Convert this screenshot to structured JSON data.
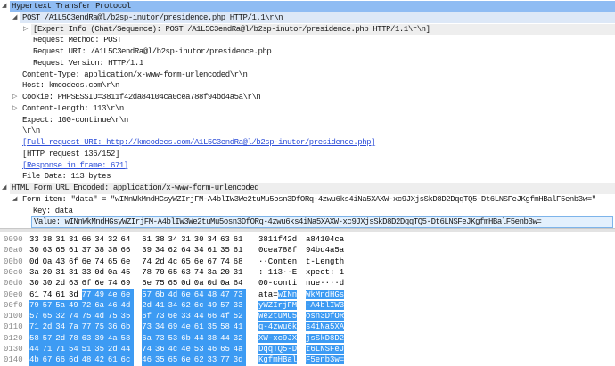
{
  "tree": [
    {
      "indent": 0,
      "toggle": "expanded",
      "text": "Hypertext Transfer Protocol",
      "style": "sel1"
    },
    {
      "indent": 1,
      "toggle": "expanded",
      "text": "POST /A1L5C3endRa@l/b2sp-inutor/presidence.php HTTP/1.1\\r\\n",
      "style": "sel2"
    },
    {
      "indent": 2,
      "toggle": "collapsed",
      "text": "[Expert Info (Chat/Sequence): POST /A1L5C3endRa@l/b2sp-inutor/presidence.php HTTP/1.1\\r\\n]",
      "style": "gray"
    },
    {
      "indent": 2,
      "toggle": "",
      "text": "Request Method: POST",
      "style": ""
    },
    {
      "indent": 2,
      "toggle": "",
      "text": "Request URI: /A1L5C3endRa@l/b2sp-inutor/presidence.php",
      "style": ""
    },
    {
      "indent": 2,
      "toggle": "",
      "text": "Request Version: HTTP/1.1",
      "style": ""
    },
    {
      "indent": 1,
      "toggle": "",
      "text": "Content-Type: application/x-www-form-urlencoded\\r\\n",
      "style": ""
    },
    {
      "indent": 1,
      "toggle": "",
      "text": "Host: kmcodecs.com\\r\\n",
      "style": ""
    },
    {
      "indent": 1,
      "toggle": "collapsed",
      "text": "Cookie: PHPSESSID=3811f42da84104ca0cea788f94bd4a5a\\r\\n",
      "style": ""
    },
    {
      "indent": 1,
      "toggle": "collapsed",
      "text": "Content-Length: 113\\r\\n",
      "style": ""
    },
    {
      "indent": 1,
      "toggle": "",
      "text": "Expect: 100-continue\\r\\n",
      "style": ""
    },
    {
      "indent": 1,
      "toggle": "",
      "text": "\\r\\n",
      "style": ""
    },
    {
      "indent": 1,
      "toggle": "",
      "text": "[Full request URI: http://kmcodecs.com/A1L5C3endRa@l/b2sp-inutor/presidence.php]",
      "style": "link"
    },
    {
      "indent": 1,
      "toggle": "",
      "text": "[HTTP request 136/152]",
      "style": ""
    },
    {
      "indent": 1,
      "toggle": "",
      "text": "[Response in frame: 671]",
      "style": "link"
    },
    {
      "indent": 1,
      "toggle": "",
      "text": "File Data: 113 bytes",
      "style": ""
    },
    {
      "indent": 0,
      "toggle": "expanded",
      "text": "HTML Form URL Encoded: application/x-www-form-urlencoded",
      "style": "gray"
    },
    {
      "indent": 1,
      "toggle": "expanded",
      "text": "Form item: \"data\" = \"wINnWkMndHGsyWZIrjFM-A4blIW3We2tuMu5osn3DfORq-4zwu6ks4iNa5XAXW-xc9JXjsSkD8D2DqqTQ5-Dt6LNSFeJKgfmHBalF5enb3w=\"",
      "style": ""
    },
    {
      "indent": 2,
      "toggle": "",
      "text": "Key: data",
      "style": ""
    },
    {
      "indent": 2,
      "toggle": "",
      "text": "Value: wINnWkMndHGsyWZIrjFM-A4blIW3We2tuMu5osn3DfORq-4zwu6ks4iNa5XAXW-xc9JXjsSkD8D2DqqTQ5-Dt6LNSFeJKgfmHBalF5enb3w=",
      "style": "valsel"
    }
  ],
  "hex": [
    {
      "offset": "0090",
      "bytes": "33 38 31 31 66 34 32 64 61 38 34 31 30 34 63 61",
      "ascii": [
        "3811f42d",
        "a84104ca"
      ],
      "sel_from": 16
    },
    {
      "offset": "00a0",
      "bytes": "30 63 65 61 37 38 38 66 39 34 62 64 34 61 35 61",
      "ascii": [
        "0cea788f",
        "94bd4a5a"
      ],
      "sel_from": 16
    },
    {
      "offset": "00b0",
      "bytes": "0d 0a 43 6f 6e 74 65 6e 74 2d 4c 65 6e 67 74 68",
      "ascii": [
        "··Conten",
        "t-Length"
      ],
      "sel_from": 16
    },
    {
      "offset": "00c0",
      "bytes": "3a 20 31 31 33 0d 0a 45 78 70 65 63 74 3a 20 31",
      "ascii": [
        ": 113··E",
        "xpect: 1"
      ],
      "sel_from": 16
    },
    {
      "offset": "00d0",
      "bytes": "30 30 2d 63 6f 6e 74 69 6e 75 65 0d 0a 0d 0a 64",
      "ascii": [
        "00-conti",
        "nue····d"
      ],
      "sel_from": 16
    },
    {
      "offset": "00e0",
      "bytes": "61 74 61 3d 77 49 4e 6e 57 6b 4d 6e 64 48 47 73",
      "ascii": [
        "ata=wINn",
        "WkMndHGs"
      ],
      "sel_from": 4
    },
    {
      "offset": "00f0",
      "bytes": "79 57 5a 49 72 6a 46 4d 2d 41 34 62 6c 49 57 33",
      "ascii": [
        "yWZIrjFM",
        "-A4blIW3"
      ],
      "sel_from": 0
    },
    {
      "offset": "0100",
      "bytes": "57 65 32 74 75 4d 75 35 6f 73 6e 33 44 66 4f 52",
      "ascii": [
        "We2tuMu5",
        "osn3DfOR"
      ],
      "sel_from": 0
    },
    {
      "offset": "0110",
      "bytes": "71 2d 34 7a 77 75 36 6b 73 34 69 4e 61 35 58 41",
      "ascii": [
        "q-4zwu6k",
        "s4iNa5XA"
      ],
      "sel_from": 0
    },
    {
      "offset": "0120",
      "bytes": "58 57 2d 78 63 39 4a 58 6a 73 53 6b 44 38 44 32",
      "ascii": [
        "XW-xc9JX",
        "jsSkD8D2"
      ],
      "sel_from": 0
    },
    {
      "offset": "0130",
      "bytes": "44 71 71 54 51 35 2d 44 74 36 4c 4e 53 46 65 4a",
      "ascii": [
        "DqqTQ5-D",
        "t6LNSFeJ"
      ],
      "sel_from": 0
    },
    {
      "offset": "0140",
      "bytes": "4b 67 66 6d 48 42 61 6c 46 35 65 6e 62 33 77 3d",
      "ascii": [
        "KgfmHBal",
        "F5enb3w="
      ],
      "sel_from": 0
    }
  ],
  "colors": {
    "selection": "#3d9bf3",
    "tree_selected": "#8fbcf3",
    "link": "#2d4ed8"
  }
}
